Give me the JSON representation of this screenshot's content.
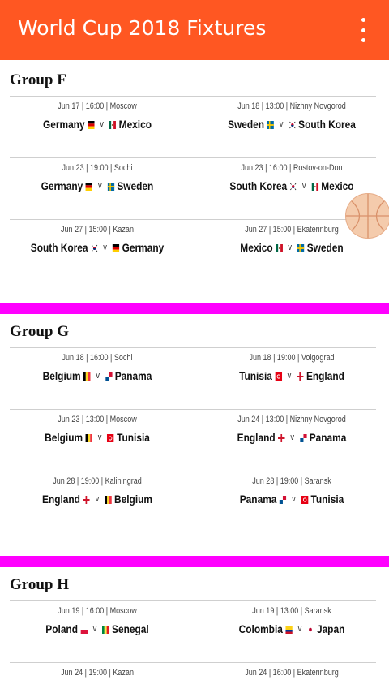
{
  "appbar": {
    "title": "World Cup 2018 Fixtures",
    "menu_icon": "more-vert-icon",
    "color": "#ff5722"
  },
  "divider_color": "#ff00ff",
  "groups": [
    {
      "name": "Group F",
      "matches": [
        {
          "meta": "Jun 17 | 16:00 | Moscow",
          "home": "Germany",
          "home_flag": "germany",
          "away": "Mexico",
          "away_flag": "mexico"
        },
        {
          "meta": "Jun 18 | 13:00 | Nizhny Novgorod",
          "home": "Sweden",
          "home_flag": "sweden",
          "away": "South Korea",
          "away_flag": "south-korea"
        },
        {
          "meta": "Jun 23 | 19:00 | Sochi",
          "home": "Germany",
          "home_flag": "germany",
          "away": "Sweden",
          "away_flag": "sweden"
        },
        {
          "meta": "Jun 23 | 16:00 | Rostov-on-Don",
          "home": "South Korea",
          "home_flag": "south-korea",
          "away": "Mexico",
          "away_flag": "mexico"
        },
        {
          "meta": "Jun 27 | 15:00 | Kazan",
          "home": "South Korea",
          "home_flag": "south-korea",
          "away": "Germany",
          "away_flag": "germany"
        },
        {
          "meta": "Jun 27 | 15:00 | Ekaterinburg",
          "home": "Mexico",
          "home_flag": "mexico",
          "away": "Sweden",
          "away_flag": "sweden"
        }
      ]
    },
    {
      "name": "Group G",
      "matches": [
        {
          "meta": "Jun 18 | 16:00 | Sochi",
          "home": "Belgium",
          "home_flag": "belgium",
          "away": "Panama",
          "away_flag": "panama"
        },
        {
          "meta": "Jun 18 | 19:00 | Volgograd",
          "home": "Tunisia",
          "home_flag": "tunisia",
          "away": "England",
          "away_flag": "england"
        },
        {
          "meta": "Jun 23 | 13:00 | Moscow",
          "home": "Belgium",
          "home_flag": "belgium",
          "away": "Tunisia",
          "away_flag": "tunisia"
        },
        {
          "meta": "Jun 24 | 13:00 | Nizhny Novgorod",
          "home": "England",
          "home_flag": "england",
          "away": "Panama",
          "away_flag": "panama"
        },
        {
          "meta": "Jun 28 | 19:00 | Kaliningrad",
          "home": "England",
          "home_flag": "england",
          "away": "Belgium",
          "away_flag": "belgium"
        },
        {
          "meta": "Jun 28 | 19:00 | Saransk",
          "home": "Panama",
          "home_flag": "panama",
          "away": "Tunisia",
          "away_flag": "tunisia"
        }
      ]
    },
    {
      "name": "Group H",
      "matches": [
        {
          "meta": "Jun 19 | 16:00 | Moscow",
          "home": "Poland",
          "home_flag": "poland",
          "away": "Senegal",
          "away_flag": "senegal"
        },
        {
          "meta": "Jun 19 | 13:00 | Saransk",
          "home": "Colombia",
          "home_flag": "colombia",
          "away": "Japan",
          "away_flag": "japan"
        },
        {
          "meta": "Jun 24 | 19:00 | Kazan",
          "home": "",
          "home_flag": "",
          "away": "",
          "away_flag": ""
        },
        {
          "meta": "Jun 24 | 16:00 | Ekaterinburg",
          "home": "",
          "home_flag": "",
          "away": "",
          "away_flag": ""
        }
      ]
    }
  ],
  "versus": "v",
  "floating_ball_icon": "basketball-icon"
}
